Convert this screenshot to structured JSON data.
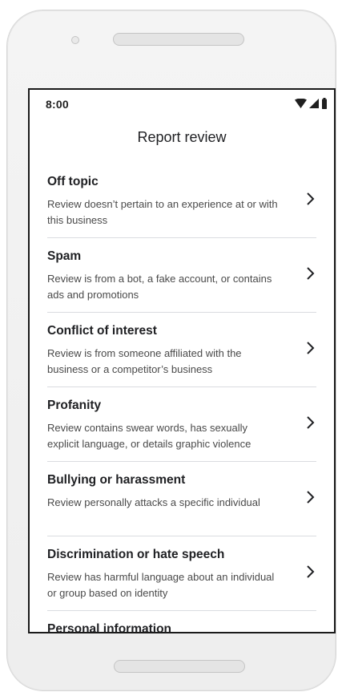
{
  "status_bar": {
    "time": "8:00",
    "icons": [
      "wifi-icon",
      "cellular-signal-icon",
      "battery-icon"
    ]
  },
  "page": {
    "title": "Report review"
  },
  "options": [
    {
      "title": "Off topic",
      "description": "Review doesn’t pertain to an experience at or with this business"
    },
    {
      "title": "Spam",
      "description": "Review is from a bot, a fake account, or contains ads and promotions"
    },
    {
      "title": "Conflict of interest",
      "description": "Review is from someone affiliated with the business or a competitor’s business"
    },
    {
      "title": "Profanity",
      "description": "Review contains swear words, has sexually explicit language, or details graphic violence"
    },
    {
      "title": "Bullying or harassment",
      "description": "Review personally attacks a specific individual"
    },
    {
      "title": "Discrimination or hate speech",
      "description": "Review has harmful language about an individual or group based on identity"
    },
    {
      "title": "Personal information",
      "description": ""
    }
  ],
  "colors": {
    "text_primary": "#202124",
    "text_secondary": "#4a4a4a",
    "divider": "#dadce0",
    "device_frame": "#f0f0f0"
  }
}
